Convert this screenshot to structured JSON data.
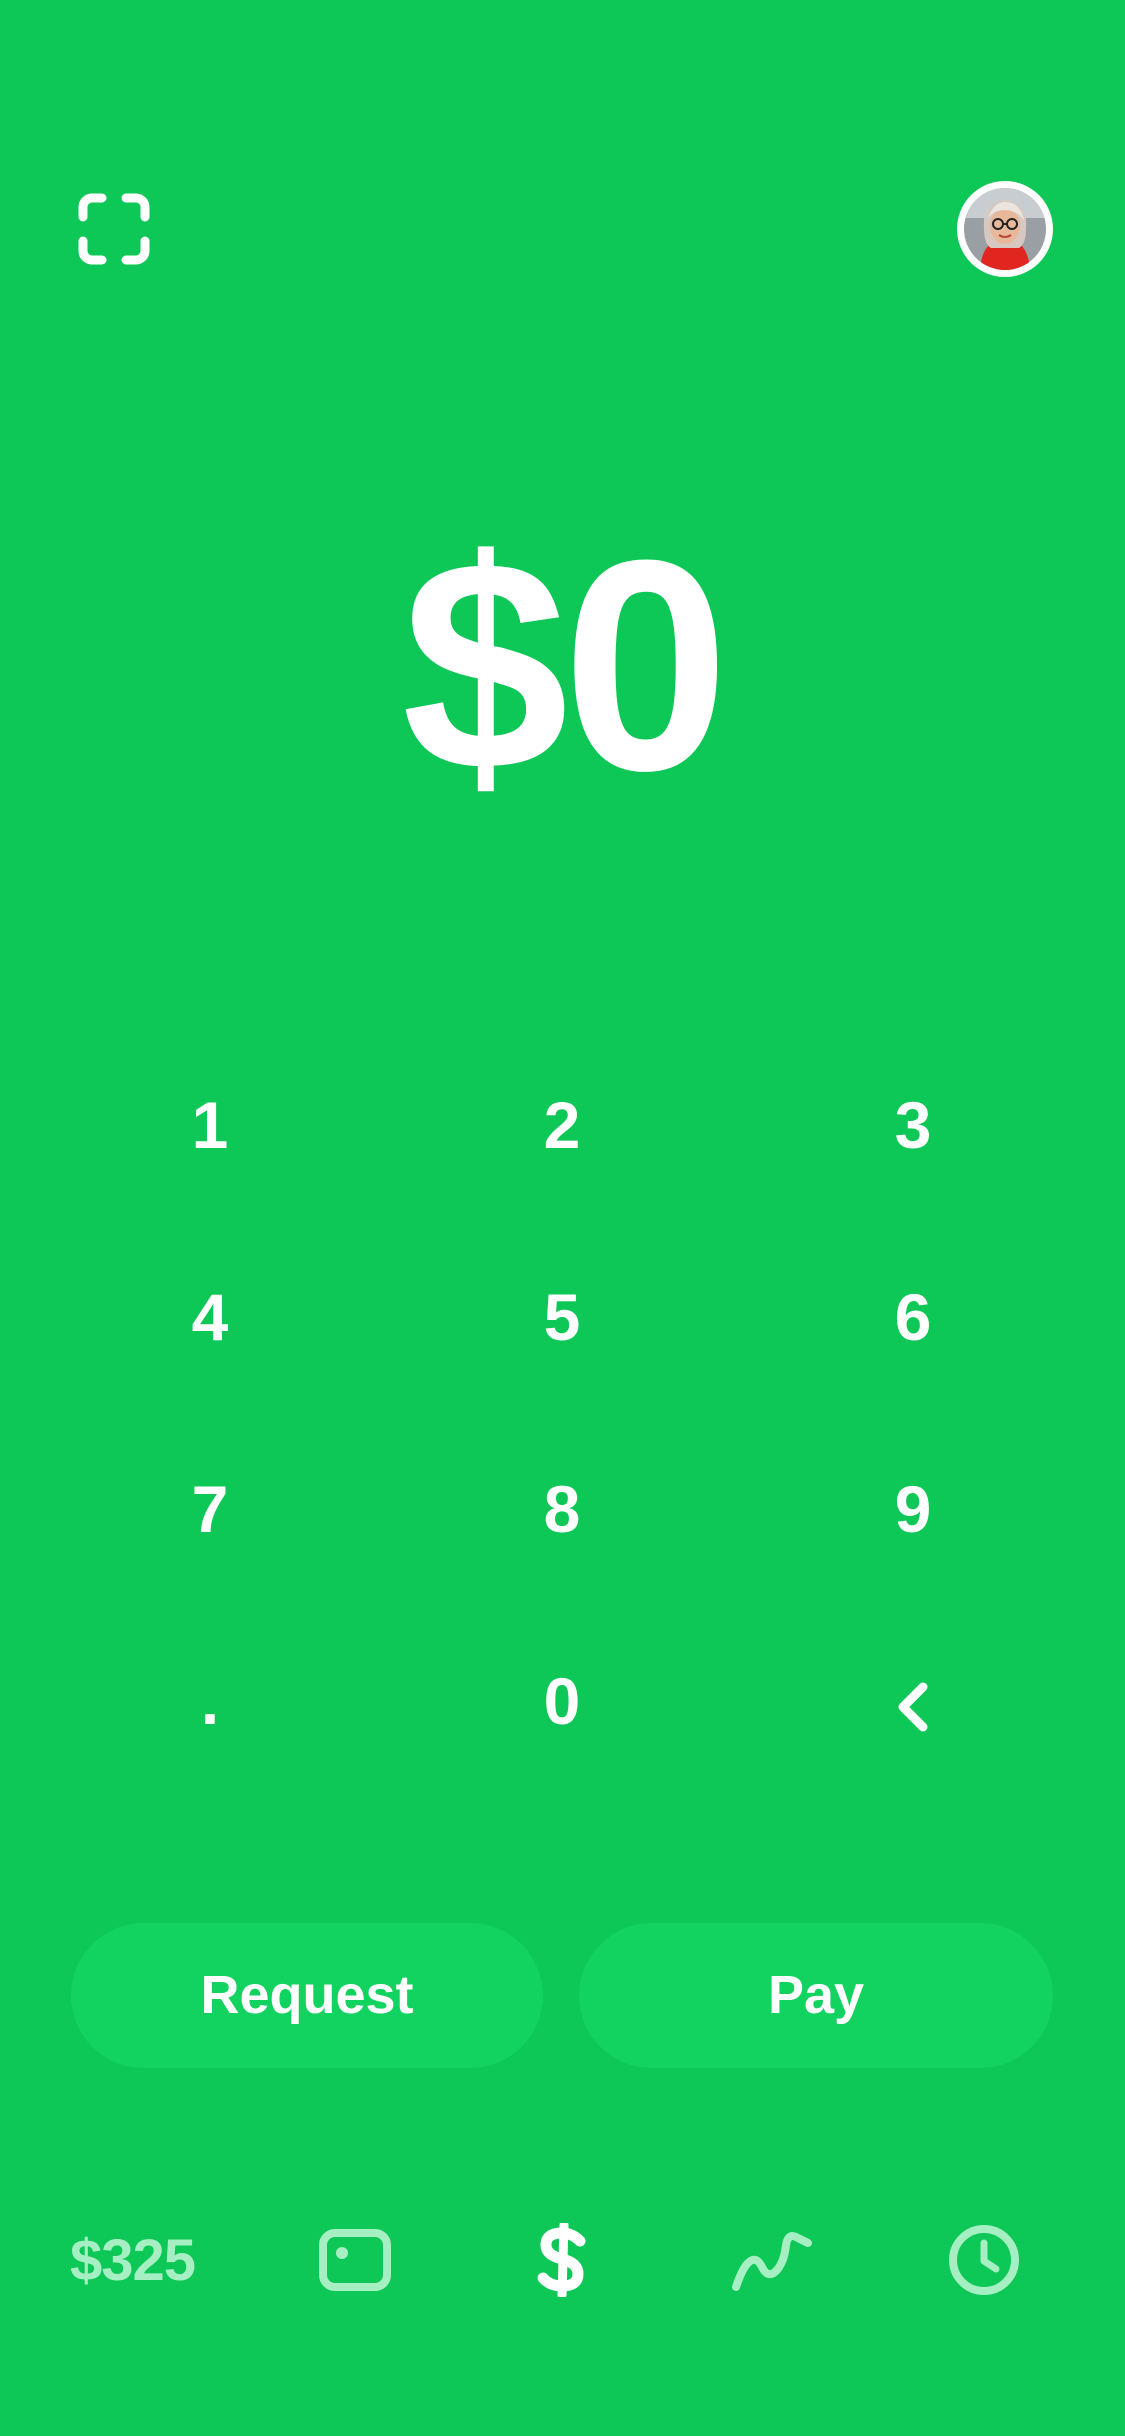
{
  "header": {
    "scan_icon": "scan-qr-icon",
    "avatar_icon": "profile-photo"
  },
  "amount": {
    "display": "$0"
  },
  "keypad": {
    "keys": [
      "1",
      "2",
      "3",
      "4",
      "5",
      "6",
      "7",
      "8",
      "9",
      ".",
      "0"
    ],
    "backspace_icon": "chevron-left-icon"
  },
  "actions": {
    "request_label": "Request",
    "pay_label": "Pay"
  },
  "bottom_nav": {
    "balance": "$325",
    "items": [
      "card-icon",
      "dollar-icon",
      "investing-icon",
      "clock-icon"
    ],
    "active": "dollar-icon"
  },
  "colors": {
    "background": "#0dc756",
    "button": "#12d35f",
    "foreground": "#ffffff",
    "inactive_nav": "#a6efc3"
  }
}
